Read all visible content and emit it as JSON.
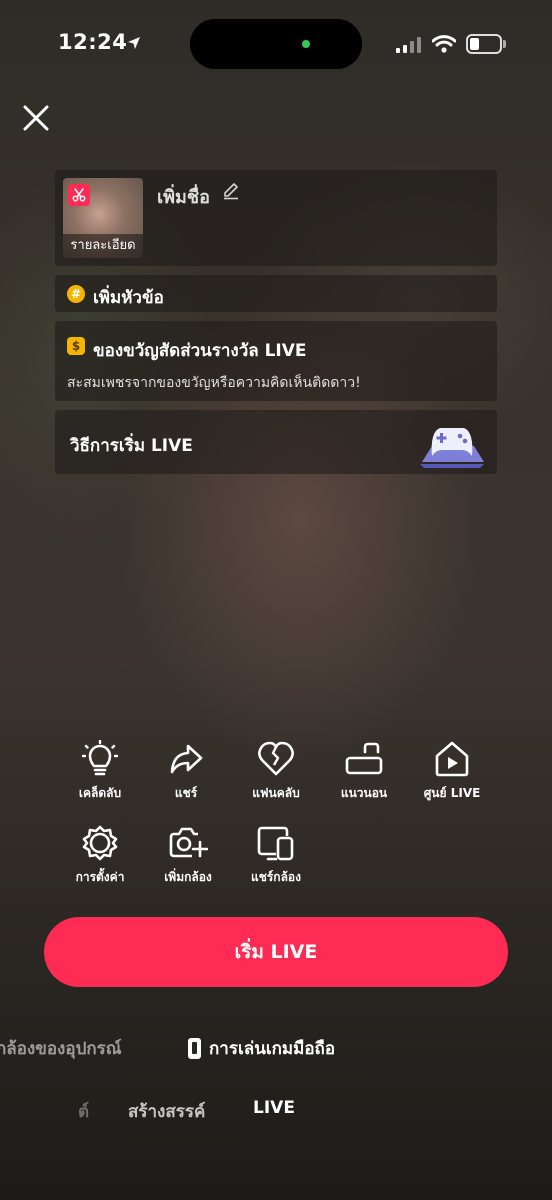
{
  "status_bar": {
    "time": "12:24"
  },
  "colors": {
    "accent": "#fe2c55",
    "badge_yellow": "#f5b400"
  },
  "setup": {
    "cover_label": "รายละเอียด",
    "add_title": "เพิ่มชื่อ",
    "add_topic": "เพิ่มหัวข้อ",
    "topic_badge": "#",
    "gift_badge": "$",
    "gift_title": "ของขวัญสัดส่วนรางวัล LIVE",
    "gift_desc": "สะสมเพชรจากของขวัญหรือความคิดเห็นติดดาว!",
    "how_to": "วิธีการเริ่ม LIVE"
  },
  "tools": [
    {
      "label": "เคล็ดลับ",
      "icon": "lightbulb-icon"
    },
    {
      "label": "แชร์",
      "icon": "share-icon"
    },
    {
      "label": "แฟนคลับ",
      "icon": "heart-icon"
    },
    {
      "label": "แนวนอน",
      "icon": "landscape-icon"
    },
    {
      "label": "ศูนย์ LIVE",
      "icon": "live-center-icon"
    },
    {
      "label": "การตั้งค่า",
      "icon": "settings-icon"
    },
    {
      "label": "เพิ่มกล้อง",
      "icon": "add-camera-icon"
    },
    {
      "label": "แชร์กล้อง",
      "icon": "share-camera-icon"
    }
  ],
  "start_button": "เริ่ม LIVE",
  "sources": {
    "camera": "กล้องของอุปกรณ์",
    "mobile_game": "การเล่นเกมมือถือ"
  },
  "modes": {
    "left_partial": "ต์",
    "create": "สร้างสรรค์",
    "live": "LIVE"
  }
}
